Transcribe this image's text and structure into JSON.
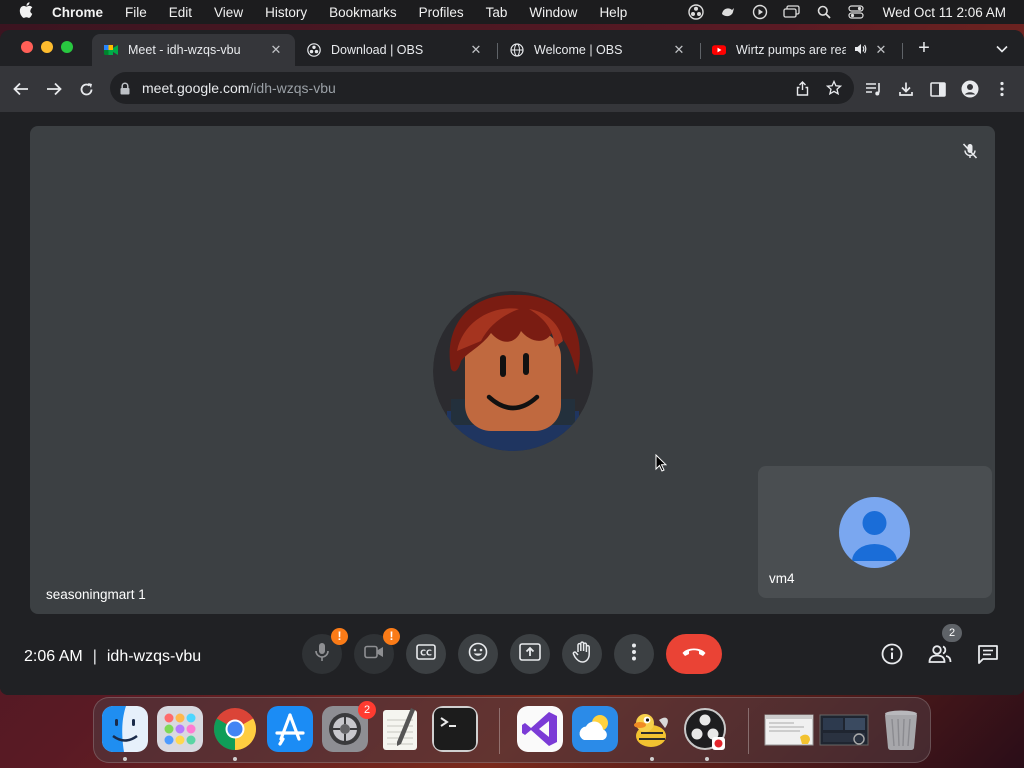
{
  "menubar": {
    "app_name": "Chrome",
    "menus": [
      "File",
      "Edit",
      "View",
      "History",
      "Bookmarks",
      "Profiles",
      "Tab",
      "Window",
      "Help"
    ],
    "clock": "Wed Oct 11  2:06 AM"
  },
  "tabs": [
    {
      "title": "Meet - idh-wzqs-vbu",
      "favicon": "google-meet-icon",
      "active": true
    },
    {
      "title": "Download | OBS",
      "favicon": "obs-icon",
      "active": false
    },
    {
      "title": "Welcome | OBS",
      "favicon": "globe-icon",
      "active": false
    },
    {
      "title": "Wirtz pumps are rea",
      "favicon": "youtube-icon",
      "active": false,
      "audio": true
    }
  ],
  "address_bar": {
    "host": "meet.google.com",
    "path": "/idh-wzqs-vbu"
  },
  "meet": {
    "main_participant": "seasoningmart 1",
    "self_participant": "vm4",
    "time": "2:06 AM",
    "separator": "|",
    "meeting_code": "idh-wzqs-vbu",
    "participant_count": "2",
    "warning_mark": "!"
  },
  "colors": {
    "leave_button": "#ea4335",
    "warning_badge": "#fa7b17",
    "stage_bg": "#3c4043",
    "self_avatar": "#7aa7f0"
  },
  "dock": {
    "apps": [
      "Finder",
      "Launchpad",
      "Google Chrome",
      "App Store",
      "System Settings",
      "TextEdit",
      "Terminal",
      "Visual Studio",
      "Weather",
      "Cyberduck",
      "OBS",
      "Screenshot 1",
      "Screenshot 2",
      "Trash"
    ],
    "settings_badge": "2"
  }
}
